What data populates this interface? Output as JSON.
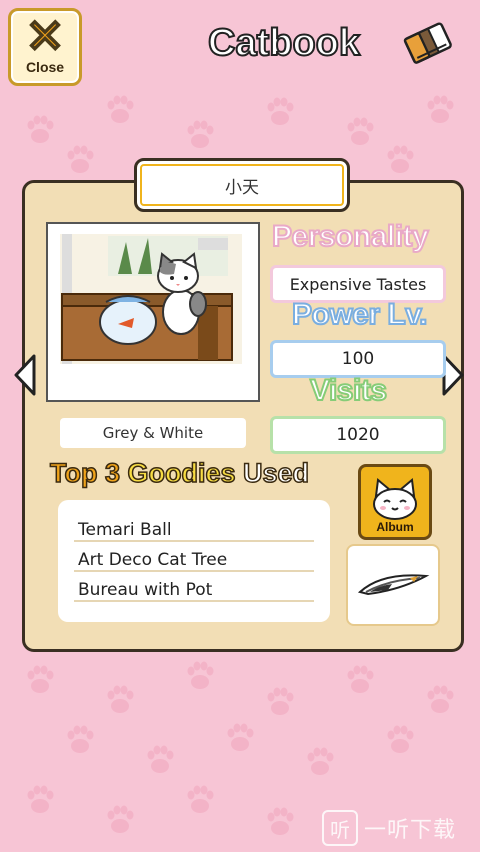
{
  "header": {
    "close_label": "Close",
    "title": "Catbook"
  },
  "cat": {
    "name": "小天",
    "color": "Grey & White",
    "personality_label": "Personality",
    "personality": "Expensive Tastes",
    "power_label": "Power Lv.",
    "power": "100",
    "visits_label": "Visits",
    "visits": "1020"
  },
  "goodies": {
    "title_a": "Top 3 ",
    "title_b": "Goodies",
    "title_c": " Used",
    "items": [
      "Temari Ball",
      "Art Deco Cat Tree",
      "Bureau with Pot"
    ]
  },
  "album": {
    "label": "Album"
  },
  "watermark": {
    "text": "一听下载",
    "logo": "听"
  },
  "colors": {
    "background": "#f7c5d5",
    "panel": "#f2deb5",
    "close_accent": "#f0a11a",
    "personality": "#e9a9c7",
    "power": "#7aaee0",
    "visits": "#86cc77"
  }
}
